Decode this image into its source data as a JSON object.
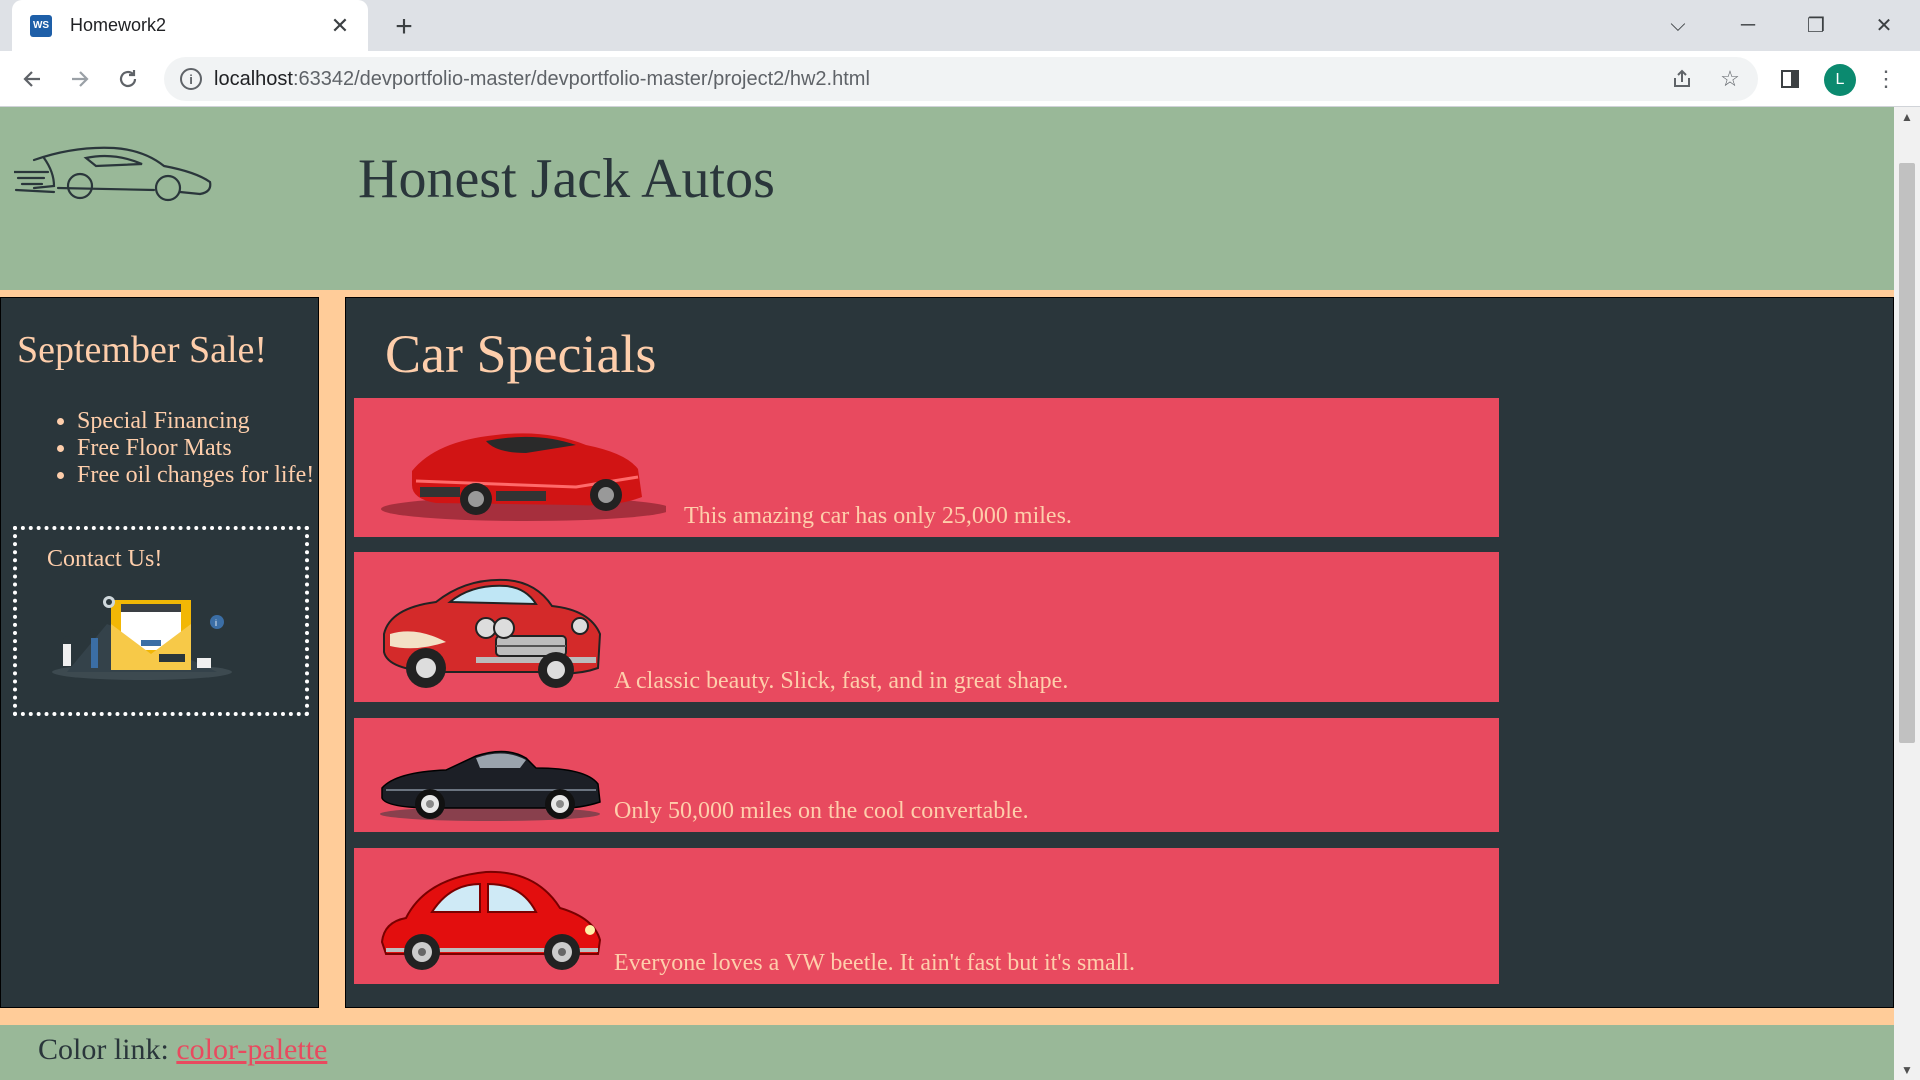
{
  "browser": {
    "tab_title": "Homework2",
    "favicon_text": "WS",
    "url_host": "localhost",
    "url_path": ":63342/devportfolio-master/devportfolio-master/project2/hw2.html",
    "profile_initial": "L"
  },
  "header": {
    "site_title": "Honest Jack Autos"
  },
  "sidebar": {
    "sale_title": "September Sale!",
    "sale_items": [
      "Special Financing",
      "Free Floor Mats",
      "Free oil changes for life!"
    ],
    "contact_title": "Contact Us!"
  },
  "main": {
    "title": "Car Specials",
    "cars": [
      {
        "description": "This amazing car has only 25,000 miles.",
        "icon": "red-sports-car-icon"
      },
      {
        "description": "A classic beauty. Slick, fast, and in great shape.",
        "icon": "classic-corvette-icon"
      },
      {
        "description": "Only 50,000 miles on the cool convertable.",
        "icon": "black-convertible-icon"
      },
      {
        "description": "Everyone loves a VW beetle. It ain't fast but it's small.",
        "icon": "vw-beetle-icon"
      }
    ]
  },
  "footer": {
    "label": "Color link: ",
    "link_text": "color-palette"
  },
  "colors": {
    "header_bg": "#99b898",
    "panel_bg": "#2a363b",
    "card_bg": "#e84a5f",
    "accent_text": "#feceab",
    "page_bg": "#ffcc99"
  }
}
